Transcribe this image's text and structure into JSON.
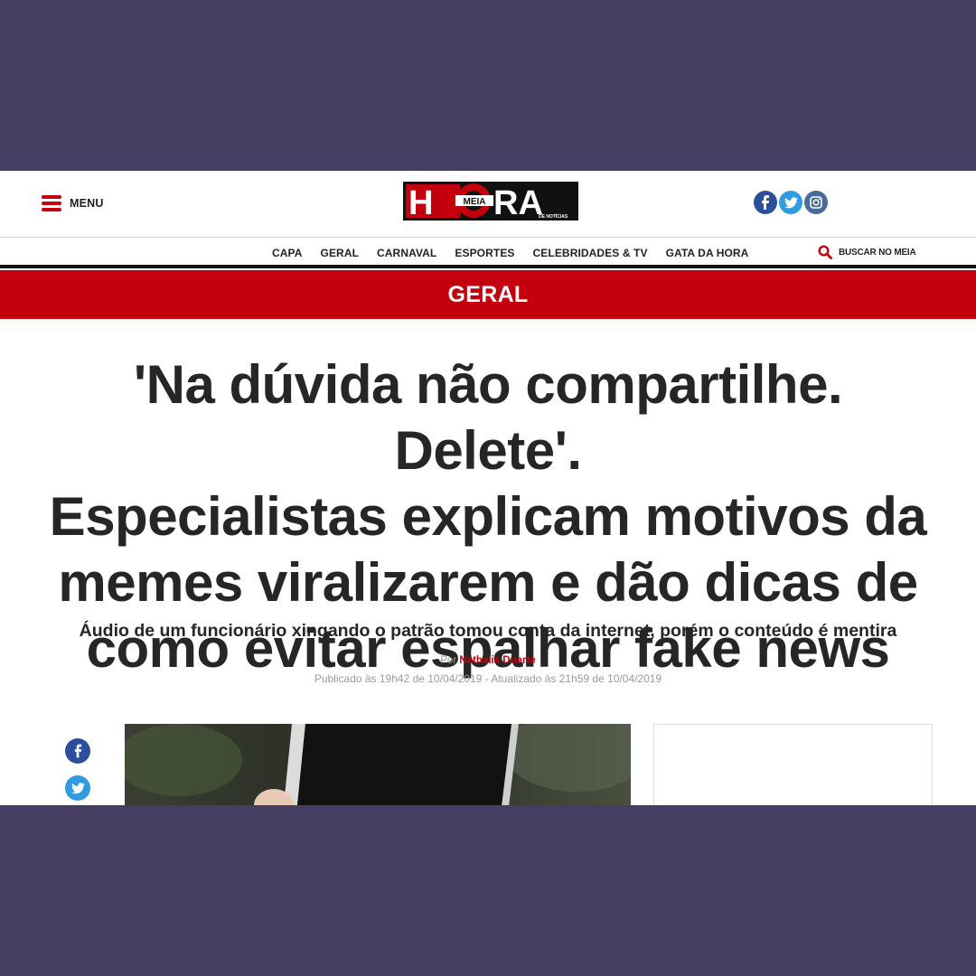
{
  "header": {
    "menu_label": "MENU",
    "logo": {
      "text_main": "H RA",
      "text_meia": "MEIA",
      "text_small": "DE NOTÍCIAS"
    },
    "socials": [
      "facebook-icon",
      "twitter-icon",
      "instagram-icon"
    ]
  },
  "nav": {
    "items": [
      "CAPA",
      "GERAL",
      "CARNAVAL",
      "ESPORTES",
      "CELEBRIDADES & TV",
      "GATA DA HORA"
    ],
    "search_label": "BUSCAR NO MEIA"
  },
  "section": {
    "label": "GERAL"
  },
  "article": {
    "headline_lines": [
      "'Na dúvida não compartilhe. Delete'.",
      "Especialistas explicam motivos da",
      "memes viralizarem e dão dicas de",
      "como evitar espalhar fake news"
    ],
    "subtitle": "Áudio de um funcionário xingando o patrão tomou conta da internet, porém o conteúdo é mentira",
    "byline_prefix": "Por",
    "author": "Nathalia Duarte",
    "dates": "Publicado às 19h42 de 10/04/2019 - Atualizado às 21h59 de 10/04/2019"
  },
  "share": [
    "facebook-icon",
    "twitter-icon"
  ],
  "colors": {
    "brand_red": "#c4000f",
    "background": "#453e62",
    "facebook": "#2d4f9b",
    "twitter": "#2f9be0"
  }
}
